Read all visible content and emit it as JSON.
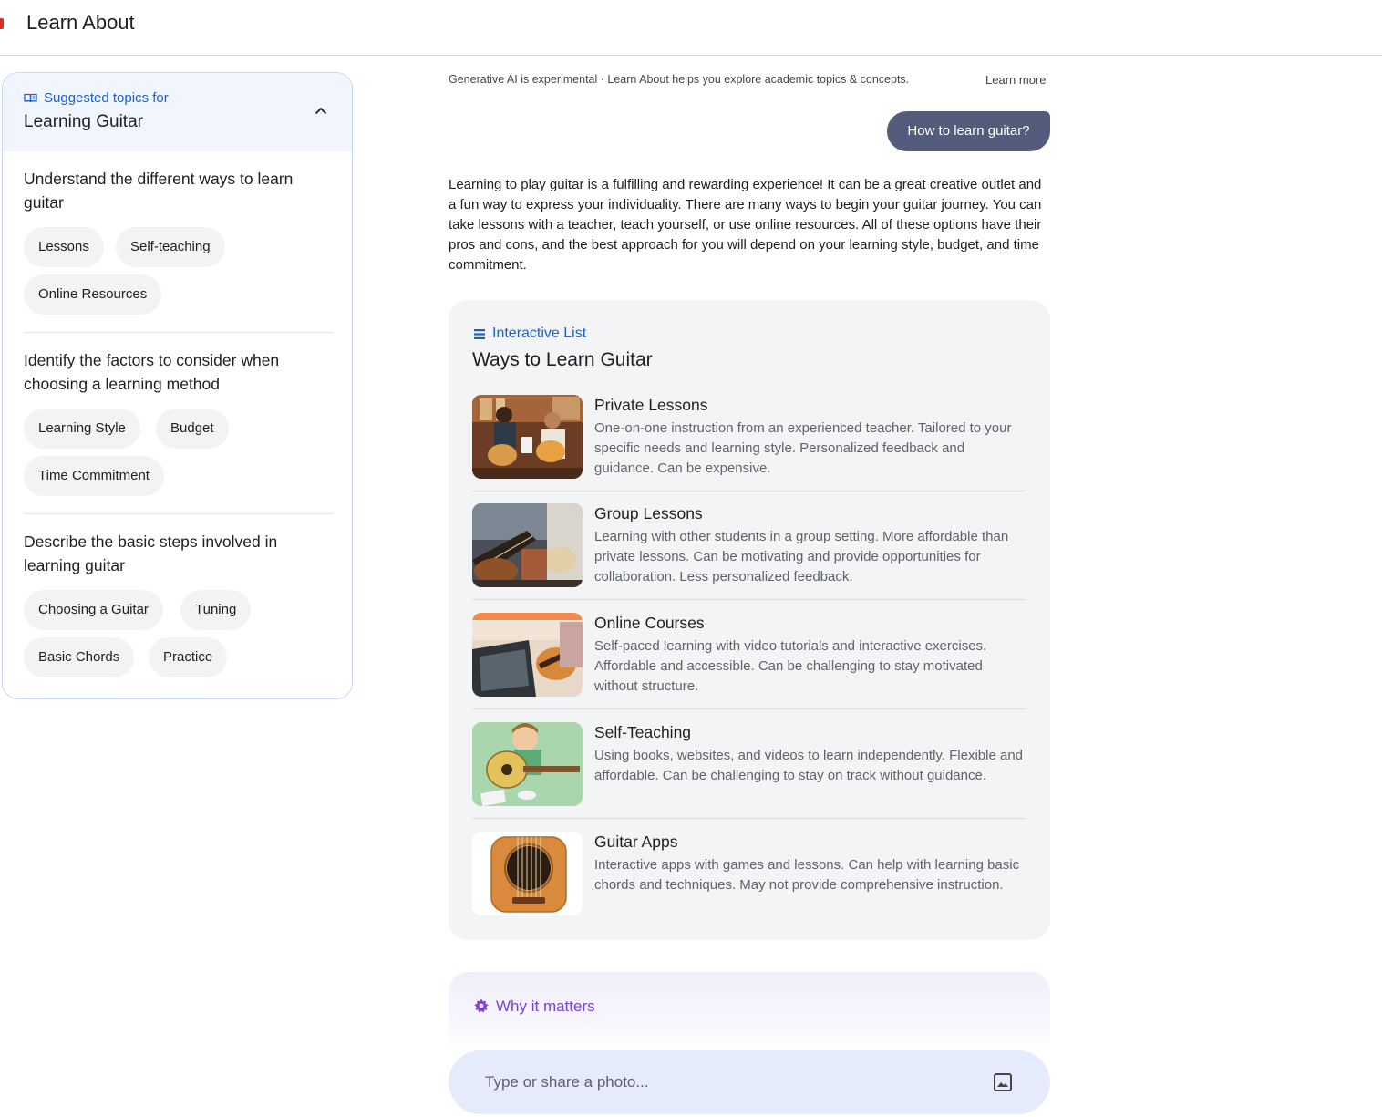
{
  "app": {
    "title": "Learn About"
  },
  "sidebar": {
    "kicker": "Suggested topics for",
    "topic": "Learning Guitar",
    "sections": [
      {
        "title": "Understand the different ways to learn guitar",
        "chips": [
          "Lessons",
          "Self-teaching",
          "Online Resources"
        ]
      },
      {
        "title": "Identify the factors to consider when choosing a learning method",
        "chips": [
          "Learning Style",
          "Budget",
          "Time Commitment"
        ]
      },
      {
        "title": "Describe the basic steps involved in learning guitar",
        "chips": [
          "Choosing a Guitar",
          "Tuning",
          "Basic Chords",
          "Practice"
        ]
      }
    ]
  },
  "main": {
    "disclaimer": "Generative AI is experimental · Learn About helps you explore academic topics & concepts.",
    "learn_more": "Learn more",
    "query": "How to learn guitar?",
    "intro": "Learning to play guitar is a fulfilling and rewarding experience! It can be a great creative outlet and a fun way to express your individuality. There are many ways to begin your guitar journey. You can take lessons with a teacher, teach yourself, or use online resources. All of these options have their pros and cons, and the best approach for you will depend on your learning style, budget, and time commitment.",
    "list": {
      "kicker": "Interactive List",
      "title": "Ways to Learn Guitar",
      "items": [
        {
          "name": "Private Lessons",
          "desc": "One-on-one instruction from an experienced teacher. Tailored to your specific needs and learning style. Personalized feedback and guidance. Can be expensive."
        },
        {
          "name": "Group Lessons",
          "desc": "Learning with other students in a group setting. More affordable than private lessons. Can be motivating and provide opportunities for collaboration. Less personalized feedback."
        },
        {
          "name": "Online Courses",
          "desc": "Self-paced learning with video tutorials and interactive exercises. Affordable and accessible. Can be challenging to stay motivated without structure."
        },
        {
          "name": "Self-Teaching",
          "desc": "Using books, websites, and videos to learn independently. Flexible and affordable. Can be challenging to stay on track without guidance."
        },
        {
          "name": "Guitar Apps",
          "desc": "Interactive apps with games and lessons. Can help with learning basic chords and techniques. May not provide comprehensive instruction."
        }
      ]
    },
    "why": {
      "label": "Why it matters"
    },
    "composer": {
      "placeholder": "Type or share a photo..."
    }
  },
  "colors": {
    "accent_blue": "#1a5fd6",
    "query_bubble": "#545c7c",
    "why_purple": "#7b3fe4",
    "composer_bg": "#e6ebfb"
  }
}
